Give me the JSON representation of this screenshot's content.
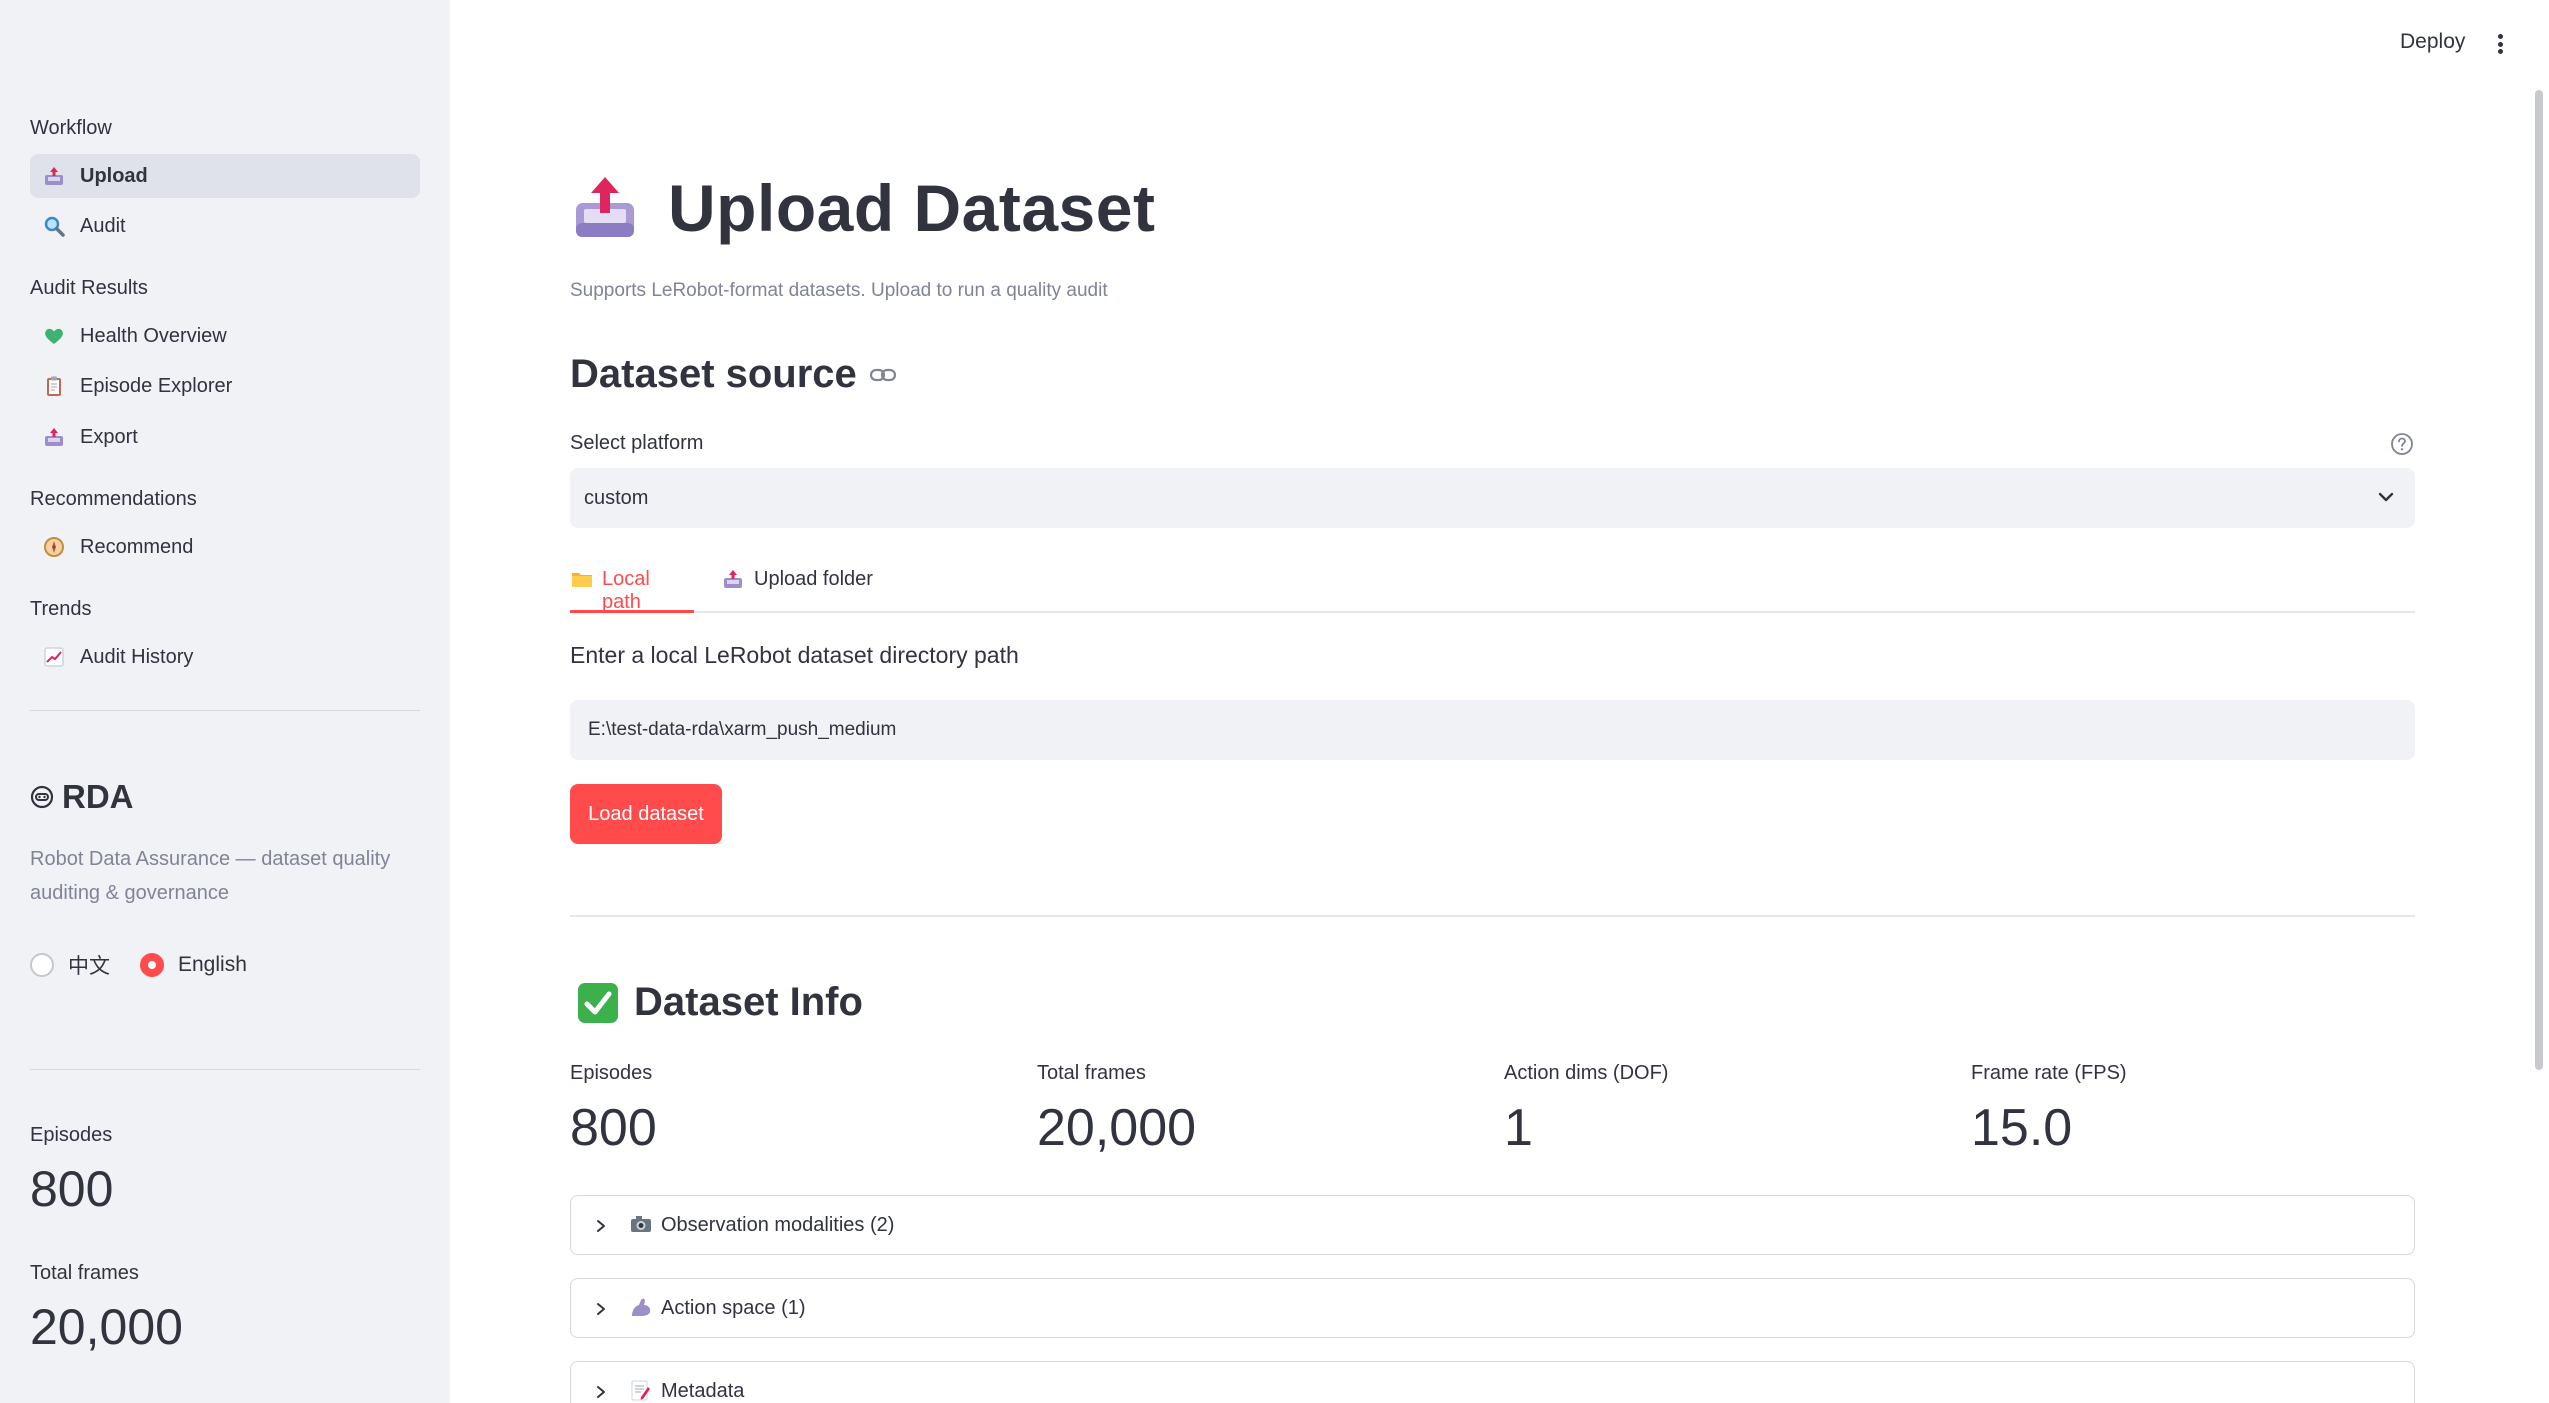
{
  "header": {
    "deploy_label": "Deploy",
    "menu_icon": "kebab-menu-icon"
  },
  "sidebar": {
    "groups": {
      "workflow": "Workflow",
      "audit_results": "Audit Results",
      "recommendations": "Recommendations",
      "trends": "Trends"
    },
    "items": [
      {
        "label": "Upload",
        "icon": "inbox-tray-icon",
        "active": true
      },
      {
        "label": "Audit",
        "icon": "magnifier-icon",
        "active": false
      },
      {
        "label": "Health Overview",
        "icon": "green-heart-icon",
        "active": false
      },
      {
        "label": "Episode Explorer",
        "icon": "clipboard-icon",
        "active": false
      },
      {
        "label": "Export",
        "icon": "inbox-tray-icon",
        "active": false
      },
      {
        "label": "Recommend",
        "icon": "compass-icon",
        "active": false
      },
      {
        "label": "Audit History",
        "icon": "chart-increasing-icon",
        "active": false
      }
    ],
    "brand": {
      "title": "RDA",
      "description": "Robot Data Assurance — dataset quality auditing & governance"
    },
    "language": {
      "options": [
        "中文",
        "English"
      ],
      "selected": "English"
    },
    "metrics": [
      {
        "label": "Episodes",
        "value": "800"
      },
      {
        "label": "Total frames",
        "value": "20,000"
      }
    ]
  },
  "main": {
    "title": "Upload Dataset",
    "caption": "Supports LeRobot-format datasets. Upload to run a quality audit",
    "source_heading": "Dataset source",
    "platform": {
      "label": "Select platform",
      "value": "custom"
    },
    "tabs": [
      {
        "label": "Local path",
        "icon": "folder-icon",
        "active": true
      },
      {
        "label": "Upload folder",
        "icon": "inbox-tray-icon",
        "active": false
      }
    ],
    "path_input": {
      "label": "Enter a local LeRobot dataset directory path",
      "value": "E:\\test-data-rda\\xarm_push_medium"
    },
    "load_button": "Load dataset",
    "info_heading": "Dataset Info",
    "metrics": [
      {
        "label": "Episodes",
        "value": "800"
      },
      {
        "label": "Total frames",
        "value": "20,000"
      },
      {
        "label": "Action dims (DOF)",
        "value": "1"
      },
      {
        "label": "Frame rate (FPS)",
        "value": "15.0"
      }
    ],
    "expanders": [
      {
        "label": "Observation modalities (2)",
        "icon": "camera-icon"
      },
      {
        "label": "Action space (1)",
        "icon": "flexed-arm-icon"
      },
      {
        "label": "Metadata",
        "icon": "memo-icon"
      }
    ]
  },
  "colors": {
    "accent": "#ff4b4b",
    "sidebar_bg": "#f0f2f6",
    "text": "#31333f",
    "muted": "#808495"
  }
}
